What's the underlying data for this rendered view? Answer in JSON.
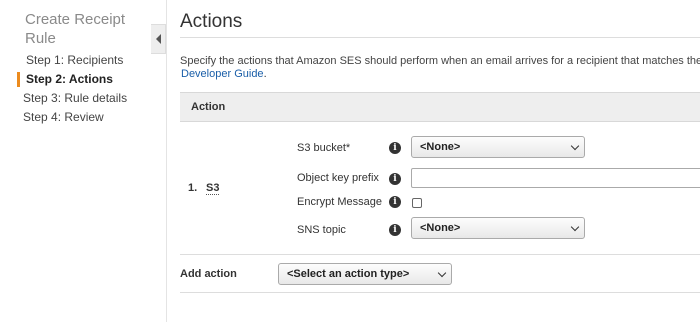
{
  "sidebar": {
    "title": "Create Receipt Rule",
    "steps": [
      {
        "label": "Step 1: Recipients"
      },
      {
        "label": "Step 2: Actions"
      },
      {
        "label": "Step 3: Rule details"
      },
      {
        "label": "Step 4: Review"
      }
    ],
    "active_step": 1
  },
  "main": {
    "title": "Actions",
    "description": "Specify the actions that Amazon SES should perform when an email arrives for a recipient that matches the co",
    "guide_link": "Developer Guide",
    "guide_suffix": ".",
    "table_header": "Action",
    "action": {
      "number": "1.",
      "type": "S3",
      "fields": {
        "s3_bucket": {
          "label": "S3 bucket*",
          "value": "<None>"
        },
        "object_key_prefix": {
          "label": "Object key prefix",
          "value": ""
        },
        "encrypt_message": {
          "label": "Encrypt Message",
          "checked": false
        },
        "sns_topic": {
          "label": "SNS topic",
          "value": "<None>"
        }
      }
    },
    "add_action": {
      "label": "Add action",
      "select_value": "<Select an action type>"
    }
  },
  "info_glyph": "i",
  "colors": {
    "active_step_marker": "#ec8b1e",
    "link": "#1a5ea8",
    "table_header_bg": "#eeeeee"
  }
}
